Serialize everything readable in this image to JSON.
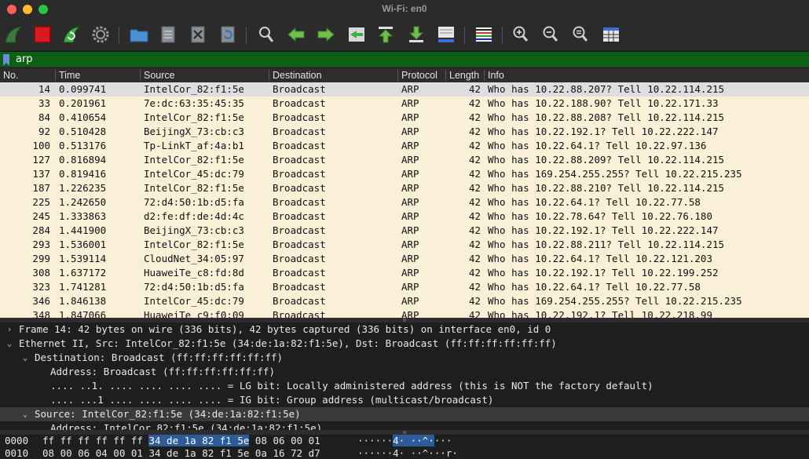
{
  "window": {
    "title": "Wi-Fi: en0"
  },
  "toolbar": {
    "icons": [
      "shark-fin-start-icon",
      "stop-capture-icon",
      "restart-capture-icon",
      "capture-options-gear-icon",
      "open-folder-icon",
      "save-file-icon",
      "close-file-icon",
      "reload-file-icon",
      "find-packet-icon",
      "go-back-icon",
      "go-forward-icon",
      "go-to-packet-icon",
      "go-first-packet-icon",
      "go-last-packet-icon",
      "auto-scroll-icon",
      "colorize-icon",
      "zoom-in-icon",
      "zoom-out-icon",
      "zoom-reset-icon",
      "resize-columns-icon"
    ]
  },
  "filter": {
    "value": "arp"
  },
  "columns": {
    "no": "No.",
    "time": "Time",
    "source": "Source",
    "destination": "Destination",
    "protocol": "Protocol",
    "length": "Length",
    "info": "Info"
  },
  "packets": [
    {
      "no": "14",
      "time": "0.099741",
      "source": "IntelCor_82:f1:5e",
      "destination": "Broadcast",
      "protocol": "ARP",
      "length": "42",
      "info": "Who has 10.22.88.207? Tell 10.22.114.215",
      "selected": true
    },
    {
      "no": "33",
      "time": "0.201961",
      "source": "7e:dc:63:35:45:35",
      "destination": "Broadcast",
      "protocol": "ARP",
      "length": "42",
      "info": "Who has 10.22.188.90? Tell 10.22.171.33"
    },
    {
      "no": "84",
      "time": "0.410654",
      "source": "IntelCor_82:f1:5e",
      "destination": "Broadcast",
      "protocol": "ARP",
      "length": "42",
      "info": "Who has 10.22.88.208? Tell 10.22.114.215"
    },
    {
      "no": "92",
      "time": "0.510428",
      "source": "BeijingX_73:cb:c3",
      "destination": "Broadcast",
      "protocol": "ARP",
      "length": "42",
      "info": "Who has 10.22.192.1? Tell 10.22.222.147"
    },
    {
      "no": "100",
      "time": "0.513176",
      "source": "Tp-LinkT_af:4a:b1",
      "destination": "Broadcast",
      "protocol": "ARP",
      "length": "42",
      "info": "Who has 10.22.64.1? Tell 10.22.97.136"
    },
    {
      "no": "127",
      "time": "0.816894",
      "source": "IntelCor_82:f1:5e",
      "destination": "Broadcast",
      "protocol": "ARP",
      "length": "42",
      "info": "Who has 10.22.88.209? Tell 10.22.114.215"
    },
    {
      "no": "137",
      "time": "0.819416",
      "source": "IntelCor_45:dc:79",
      "destination": "Broadcast",
      "protocol": "ARP",
      "length": "42",
      "info": "Who has 169.254.255.255? Tell 10.22.215.235"
    },
    {
      "no": "187",
      "time": "1.226235",
      "source": "IntelCor_82:f1:5e",
      "destination": "Broadcast",
      "protocol": "ARP",
      "length": "42",
      "info": "Who has 10.22.88.210? Tell 10.22.114.215"
    },
    {
      "no": "225",
      "time": "1.242650",
      "source": "72:d4:50:1b:d5:fa",
      "destination": "Broadcast",
      "protocol": "ARP",
      "length": "42",
      "info": "Who has 10.22.64.1? Tell 10.22.77.58"
    },
    {
      "no": "245",
      "time": "1.333863",
      "source": "d2:fe:df:de:4d:4c",
      "destination": "Broadcast",
      "protocol": "ARP",
      "length": "42",
      "info": "Who has 10.22.78.64? Tell 10.22.76.180"
    },
    {
      "no": "284",
      "time": "1.441900",
      "source": "BeijingX_73:cb:c3",
      "destination": "Broadcast",
      "protocol": "ARP",
      "length": "42",
      "info": "Who has 10.22.192.1? Tell 10.22.222.147"
    },
    {
      "no": "293",
      "time": "1.536001",
      "source": "IntelCor_82:f1:5e",
      "destination": "Broadcast",
      "protocol": "ARP",
      "length": "42",
      "info": "Who has 10.22.88.211? Tell 10.22.114.215"
    },
    {
      "no": "299",
      "time": "1.539114",
      "source": "CloudNet_34:05:97",
      "destination": "Broadcast",
      "protocol": "ARP",
      "length": "42",
      "info": "Who has 10.22.64.1? Tell 10.22.121.203"
    },
    {
      "no": "308",
      "time": "1.637172",
      "source": "HuaweiTe_c8:fd:8d",
      "destination": "Broadcast",
      "protocol": "ARP",
      "length": "42",
      "info": "Who has 10.22.192.1? Tell 10.22.199.252"
    },
    {
      "no": "323",
      "time": "1.741281",
      "source": "72:d4:50:1b:d5:fa",
      "destination": "Broadcast",
      "protocol": "ARP",
      "length": "42",
      "info": "Who has 10.22.64.1? Tell 10.22.77.58"
    },
    {
      "no": "346",
      "time": "1.846138",
      "source": "IntelCor_45:dc:79",
      "destination": "Broadcast",
      "protocol": "ARP",
      "length": "42",
      "info": "Who has 169.254.255.255? Tell 10.22.215.235"
    },
    {
      "no": "348",
      "time": "1.847066",
      "source": "HuaweiTe_c9:f0:09",
      "destination": "Broadcast",
      "protocol": "ARP",
      "length": "42",
      "info": "Who has 10.22.192.1? Tell 10.22.218.99"
    }
  ],
  "details": [
    {
      "arrow": "›",
      "level": 0,
      "text": "Frame 14: 42 bytes on wire (336 bits), 42 bytes captured (336 bits) on interface en0, id 0"
    },
    {
      "arrow": "⌄",
      "level": 0,
      "text": "Ethernet II, Src: IntelCor_82:f1:5e (34:de:1a:82:f1:5e), Dst: Broadcast (ff:ff:ff:ff:ff:ff)"
    },
    {
      "arrow": "⌄",
      "level": 1,
      "text": "Destination: Broadcast (ff:ff:ff:ff:ff:ff)"
    },
    {
      "arrow": "",
      "level": 2,
      "text": "Address: Broadcast (ff:ff:ff:ff:ff:ff)"
    },
    {
      "arrow": "",
      "level": 2,
      "text": ".... ..1. .... .... .... .... = LG bit: Locally administered address (this is NOT the factory default)"
    },
    {
      "arrow": "",
      "level": 2,
      "text": ".... ...1 .... .... .... .... = IG bit: Group address (multicast/broadcast)"
    },
    {
      "arrow": "⌄",
      "level": 1,
      "text": "Source: IntelCor_82:f1:5e (34:de:1a:82:f1:5e)",
      "selected": true
    },
    {
      "arrow": "",
      "level": 2,
      "text": "Address: IntelCor_82:f1:5e (34:de:1a:82:f1:5e)"
    }
  ],
  "bytes": [
    {
      "offset": "0000",
      "hex_pre": "ff ff ff ff ff ff ",
      "hex_hl": "34 de  1a 82 f1 5e",
      "hex_post": " 08 06 00 01",
      "ascii_pre": "······",
      "ascii_hl": "4· ··^·",
      "ascii_post": "···"
    },
    {
      "offset": "0010",
      "hex_pre": "08 00 06 04 00 01 34 de  1a 82 f1 5e 0a 16 72 d7",
      "hex_hl": "",
      "hex_post": "",
      "ascii_pre": "······4· ··^···r·",
      "ascii_hl": "",
      "ascii_post": ""
    }
  ],
  "colors": {
    "filter_valid_bg": "#0c5f13",
    "packet_row_bg": "#faf0d7",
    "selected_row_bg": "#dedede",
    "byte_highlight": "#2e5b9a"
  }
}
